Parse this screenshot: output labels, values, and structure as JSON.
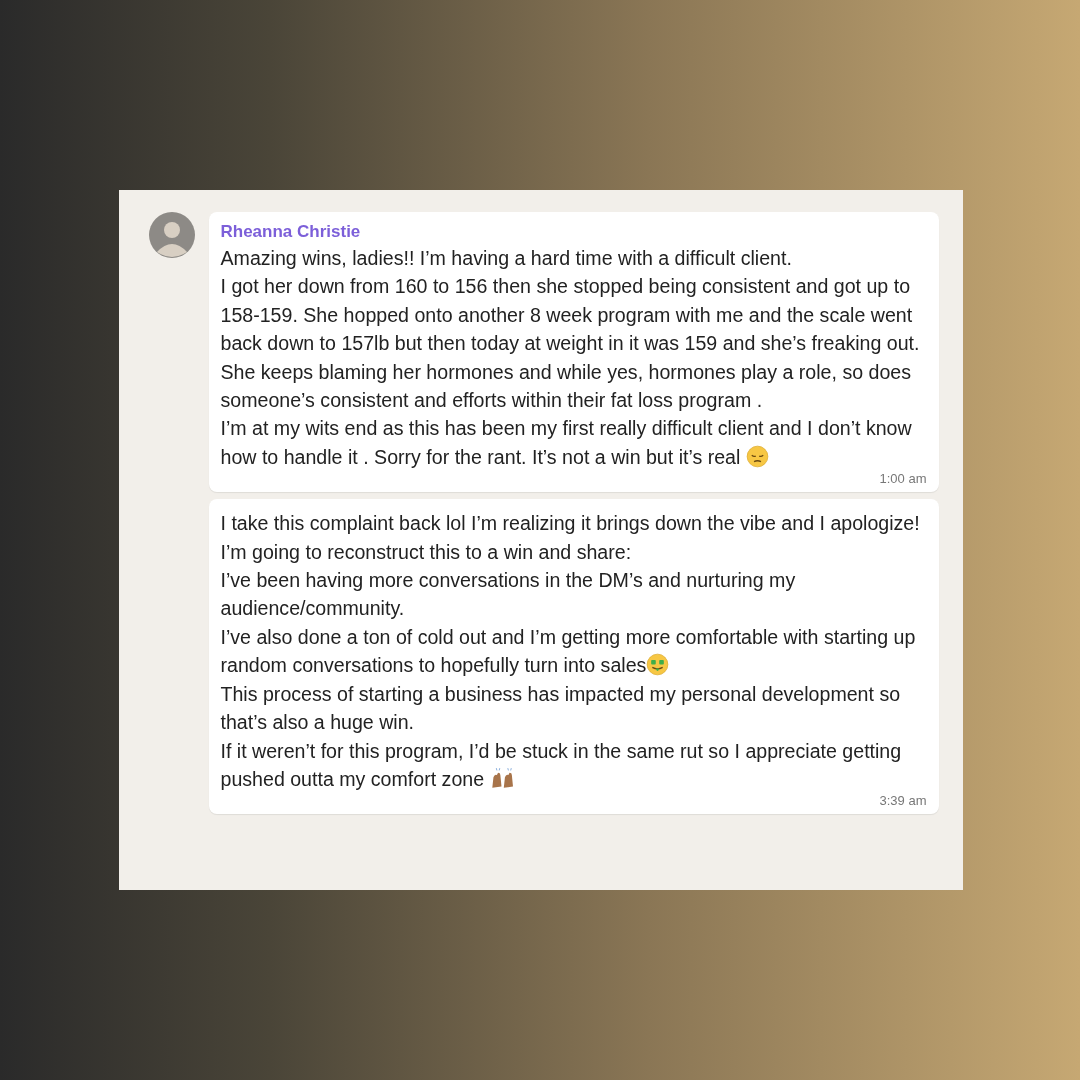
{
  "chat": {
    "messages": [
      {
        "sender": "Rheanna Christie",
        "show_avatar": true,
        "paragraphs": [
          {
            "text": "Amazing wins, ladies!! I’m having a hard time with a difficult client."
          },
          {
            "text": "I got her down from 160 to 156 then she stopped being consistent and got up to 158-159. She hopped onto another 8 week program with me and the scale went back down to 157lb but then today at weight in it was 159 and she’s freaking out."
          },
          {
            "text": "She keeps blaming her hormones and while yes, hormones play a role, so does someone’s consistent and efforts within their fat loss program ."
          },
          {
            "text": "I’m at my wits end as this has been my first really difficult client and I don’t know how to handle it . Sorry for the rant. It’s not a win but it’s real ",
            "kind": "pensive-face"
          }
        ],
        "time": "1:00 am"
      },
      {
        "show_avatar": false,
        "paragraphs": [
          {
            "text": "I take this complaint back lol I’m realizing it brings down the vibe and I apologize!"
          },
          {
            "text": "I’m going to reconstruct this to a win and share:"
          },
          {
            "text": "I’ve been having more conversations in the DM’s and nurturing my audience/community."
          },
          {
            "text": "I’ve also done a ton of cold out and I’m getting more comfortable with starting up random conversations to hopefully turn into sales",
            "kind": "money-mouth-face"
          },
          {
            "text": "This process of starting a business has impacted my personal development so that’s also a huge win."
          },
          {
            "text": "If it weren’t for this program, I’d be stuck in the same rut so I appreciate getting pushed outta my comfort zone ",
            "kind": "raised-hands"
          }
        ],
        "time": "3:39 am"
      }
    ]
  }
}
